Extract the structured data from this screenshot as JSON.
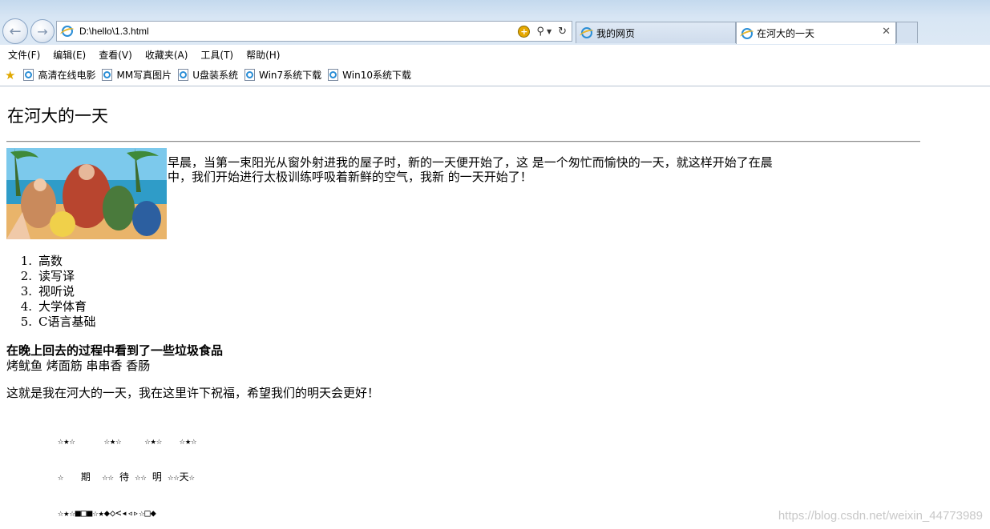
{
  "browser": {
    "address": "D:\\hello\\1.3.html",
    "tabs": [
      {
        "title": "我的网页"
      },
      {
        "title": "在河大的一天"
      }
    ],
    "menu": [
      "文件(F)",
      "编辑(E)",
      "查看(V)",
      "收藏夹(A)",
      "工具(T)",
      "帮助(H)"
    ],
    "favorites": [
      "高清在线电影",
      "MM写真图片",
      "U盘装系统",
      "Win7系统下载",
      "Win10系统下载"
    ]
  },
  "page": {
    "title": "在河大的一天",
    "paragraph_line1": "早晨，当第一束阳光从窗外射进我的屋子时，新的一天便开始了，这 是一个匆忙而愉快的一天，就这样开始了在晨",
    "paragraph_line2": "中，我们开始进行太极训练呼吸着新鲜的空气，我新 的一天开始了！",
    "courses": [
      {
        "num": "1.",
        "name": "高数"
      },
      {
        "num": "2.",
        "name": "读写译"
      },
      {
        "num": "3.",
        "name": "视听说"
      },
      {
        "num": "4.",
        "name": "大学体育"
      },
      {
        "num": "5.",
        "name": "C语言基础"
      }
    ],
    "evening_heading": "在晚上回去的过程中看到了一些垃圾食品",
    "foods": "烤鱿鱼 烤面筋 串串香 香肠",
    "closing": "这就是我在河大的一天，我在这里许下祝福，希望我们的明天会更好！",
    "symbols": [
      "☆★☆     ☆★☆    ☆★☆   ☆★☆",
      "☆   期  ☆☆ 待 ☆☆ 明 ☆☆天☆",
      "☆★☆■□■☆★◆◇<◂◃▹☆□◆"
    ]
  },
  "watermark": "https://blog.csdn.net/weixin_44773989"
}
